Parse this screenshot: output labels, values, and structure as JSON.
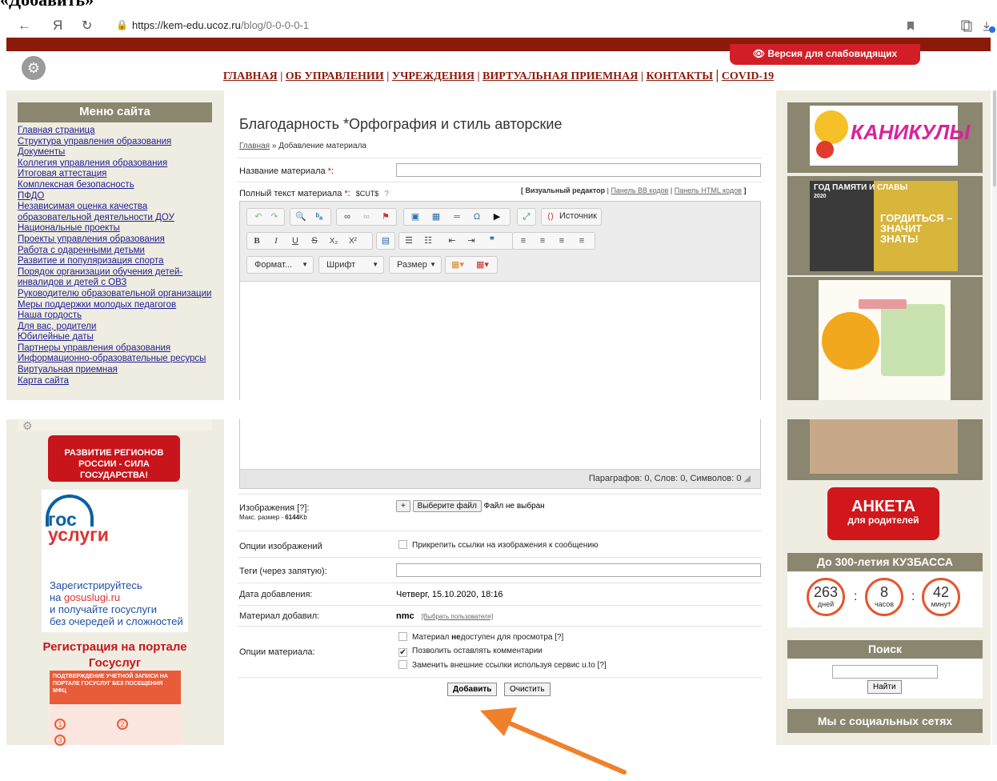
{
  "caption": "«Добавить»",
  "browser": {
    "back": "←",
    "yandex": "Я",
    "reload": "↻",
    "url_host": "https://kem-edu.ucoz.ru",
    "url_path": "/blog/0-0-0-0-1"
  },
  "header": {
    "vision_label": "Версия для слабовидящих",
    "nav": [
      "ГЛАВНАЯ",
      "ОБ УПРАВЛЕНИИ",
      "УЧРЕЖДЕНИЯ",
      "ВИРТУАЛЬНАЯ ПРИЕМНАЯ",
      "КОНТАКТЫ",
      "COVID-19"
    ]
  },
  "sidebar": {
    "title": "Меню сайта",
    "items": [
      "Главная страница",
      "Структура управления образования",
      "Документы",
      "Коллегия управления образования",
      "Итоговая аттестация",
      "Комплексная безопасность",
      "ПФДО",
      "Независимая оценка качества образовательной деятельности ДОУ",
      "Национальные проекты",
      "Проекты управления образования",
      "Работа с одаренными детьми",
      "Развитие и популяризация спорта",
      "Порядок организации обучения детей-инвалидов и детей с ОВЗ",
      "Руководителю образовательной организации",
      "Меры поддержки молодых педагогов",
      "Наша гордость",
      "Для вас, родители",
      "Юбилейные даты",
      "Партнеры управления образования",
      "Информационно-образовательные ресурсы",
      "Виртуальная приемная",
      "Карта сайта"
    ],
    "regions_banner": "РАЗВИТИЕ РЕГИОНОВ РОССИИ - СИЛА ГОСУДАРСТВА!",
    "gos_logo_1": "гос",
    "gos_logo_2": "услуги",
    "gos_text_1": "Зарегистрируйтесь",
    "gos_text_2": "на ",
    "gos_text_link": "gosuslugi.ru",
    "gos_text_3": "и получайте госуслуги",
    "gos_text_4": "без очередей и сложностей",
    "reg_title": "Регистрация на портале Госуслуг",
    "reg_img_text": "ПОДТВЕРЖДЕНИЕ УЧЕТНОЙ ЗАПИСИ НА ПОРТАЛЕ ГОСУСЛУГ БЕЗ ПОСЕЩЕНИЯ МФЦ",
    "reg_steps": [
      "1",
      "2",
      "3"
    ]
  },
  "main": {
    "title": "Благодарность *Орфография и стиль авторские",
    "breadcrumb_home": "Главная",
    "breadcrumb_sep": " » ",
    "breadcrumb_current": "Добавление материала",
    "name_label": "Название материала ",
    "required_mark": "*",
    "name_value": "",
    "fulltext_label": "Полный текст материала ",
    "cut_tag": "$CUT$",
    "help_mark": "?",
    "editor_mode_visual": "Визуальный редактор",
    "editor_mode_bb": "Панель BB кодов",
    "editor_mode_html": "Панель HTML кодов",
    "toolbar": {
      "source_label": "Источник",
      "format_label": "Формат...",
      "font_label": "Шрифт",
      "size_label": "Размер"
    },
    "status": "Параграфов: 0, Слов: 0, Символов: 0",
    "images_label": "Изображения [?]:",
    "images_max": "Макс. размер - ",
    "images_max_value": "6144",
    "images_max_unit": "Kb",
    "add_file_sign": "+",
    "choose_file": "Выберите файл",
    "no_file": "Файл не выбран",
    "image_options_label": "Опции изображений",
    "attach_links": "Прикрепить ссылки на изображения к сообщению",
    "tags_label": "Теги (через запятую):",
    "tags_value": "",
    "date_label": "Дата добавления:",
    "date_value": "Четверг, 15.10.2020, 18:16",
    "author_label": "Материал добавил:",
    "author_value": "nmc",
    "choose_user": "[Выбрать пользователя]",
    "material_options_label": "Опции материала:",
    "opt_unavailable_1": "Материал ",
    "opt_unavailable_bold": "не",
    "opt_unavailable_2": "доступен для просмотра [?]",
    "opt_allow_comments": "Позволить оставлять комментарии",
    "opt_replace_links": "Заменить внешние ссылки используя сервис u.to [?]",
    "opt_checked": [
      false,
      true,
      false
    ],
    "submit_label": "Добавить",
    "reset_label": "Очистить"
  },
  "right": {
    "kanikuly": "КАНИКУЛЫ",
    "pamyat_1": "ГОД ПАМЯТИ И СЛАВЫ",
    "pamyat_year": "2020",
    "pamyat_2": "ГОРДИТЬСЯ – ЗНАЧИТ ЗНАТЬ!",
    "anketa_1": "АНКЕТА",
    "anketa_2": "для родителей",
    "kuzbass_title": "До 300-летия КУЗБАССА",
    "timer": [
      {
        "value": "263",
        "unit": "дней"
      },
      {
        "value": "8",
        "unit": "часов"
      },
      {
        "value": "42",
        "unit": "минут"
      }
    ],
    "timer_sep": ":",
    "search_title": "Поиск",
    "search_value": "",
    "search_button": "Найти",
    "social_title": "Мы с социальных сетях"
  },
  "colors": {
    "brand_dark_red": "#8b1a0a",
    "sidebar_head": "#8a866f",
    "vision_red": "#d21f27",
    "arrow_orange": "#f0812c"
  }
}
